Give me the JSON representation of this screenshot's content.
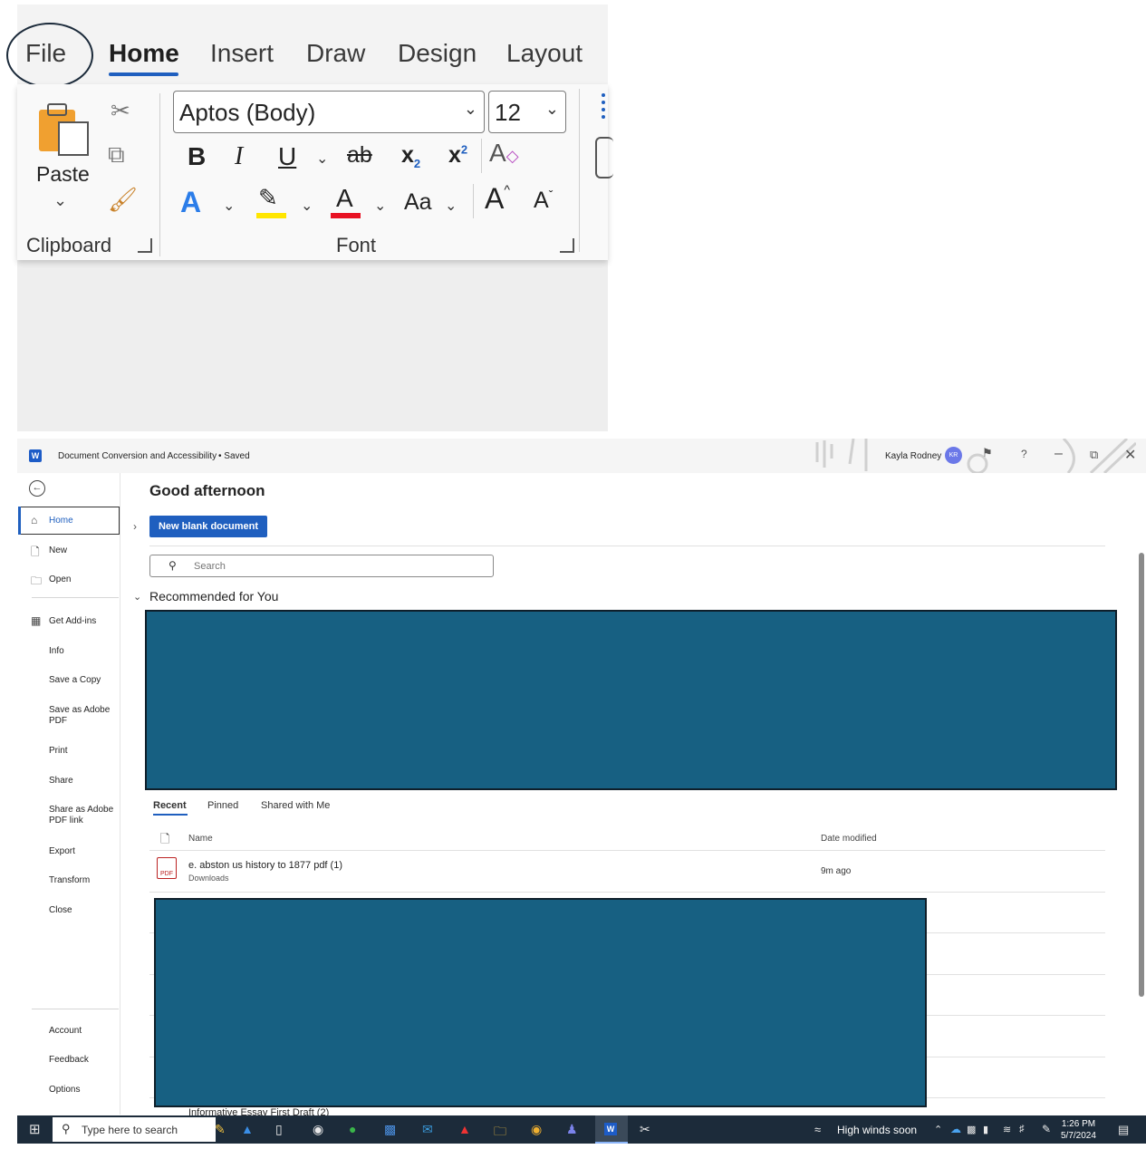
{
  "ribbon": {
    "tabs": [
      "File",
      "Home",
      "Insert",
      "Draw",
      "Design",
      "Layout"
    ],
    "active_tab": "Home",
    "clipboard": {
      "paste_label": "Paste",
      "group_label": "Clipboard"
    },
    "font": {
      "family": "Aptos (Body)",
      "size": "12",
      "group_label": "Font",
      "bold": "B",
      "italic": "I",
      "underline": "U",
      "strike": "ab",
      "sub": "x",
      "sup": "x",
      "change_case": "Aa",
      "grow": "A",
      "shrink": "A",
      "highlight_color": "#ffe600",
      "font_color": "#e81123",
      "effects_color": "#2b7de9"
    }
  },
  "titlebar": {
    "doc_title": "Document Conversion and Accessibility",
    "status": "• Saved",
    "user_name": "Kayla Rodney",
    "initials": "KR",
    "help": "?"
  },
  "sidebar": {
    "items": [
      "Home",
      "New",
      "Open",
      "Get Add-ins",
      "Info",
      "Save a Copy",
      "Save as Adobe PDF",
      "Print",
      "Share",
      "Share as Adobe PDF link",
      "Export",
      "Transform",
      "Close"
    ],
    "footer": [
      "Account",
      "Feedback",
      "Options"
    ]
  },
  "main": {
    "greeting": "Good afternoon",
    "new_blank": "New blank document",
    "search_placeholder": "Search",
    "recommended": "Recommended for You",
    "file_tabs": [
      "Recent",
      "Pinned",
      "Shared with Me"
    ],
    "columns": {
      "name": "Name",
      "date": "Date modified"
    },
    "recent_rows": [
      {
        "name": "e. abston us history to 1877 pdf (1)",
        "location": "Downloads",
        "modified": "9m ago",
        "icon": "PDF"
      },
      {
        "name": "Informative Essay First Draft (2)"
      }
    ]
  },
  "taskbar": {
    "search": "Type here to search",
    "weather": "High winds soon",
    "time": "1:26 PM",
    "date": "5/7/2024"
  }
}
